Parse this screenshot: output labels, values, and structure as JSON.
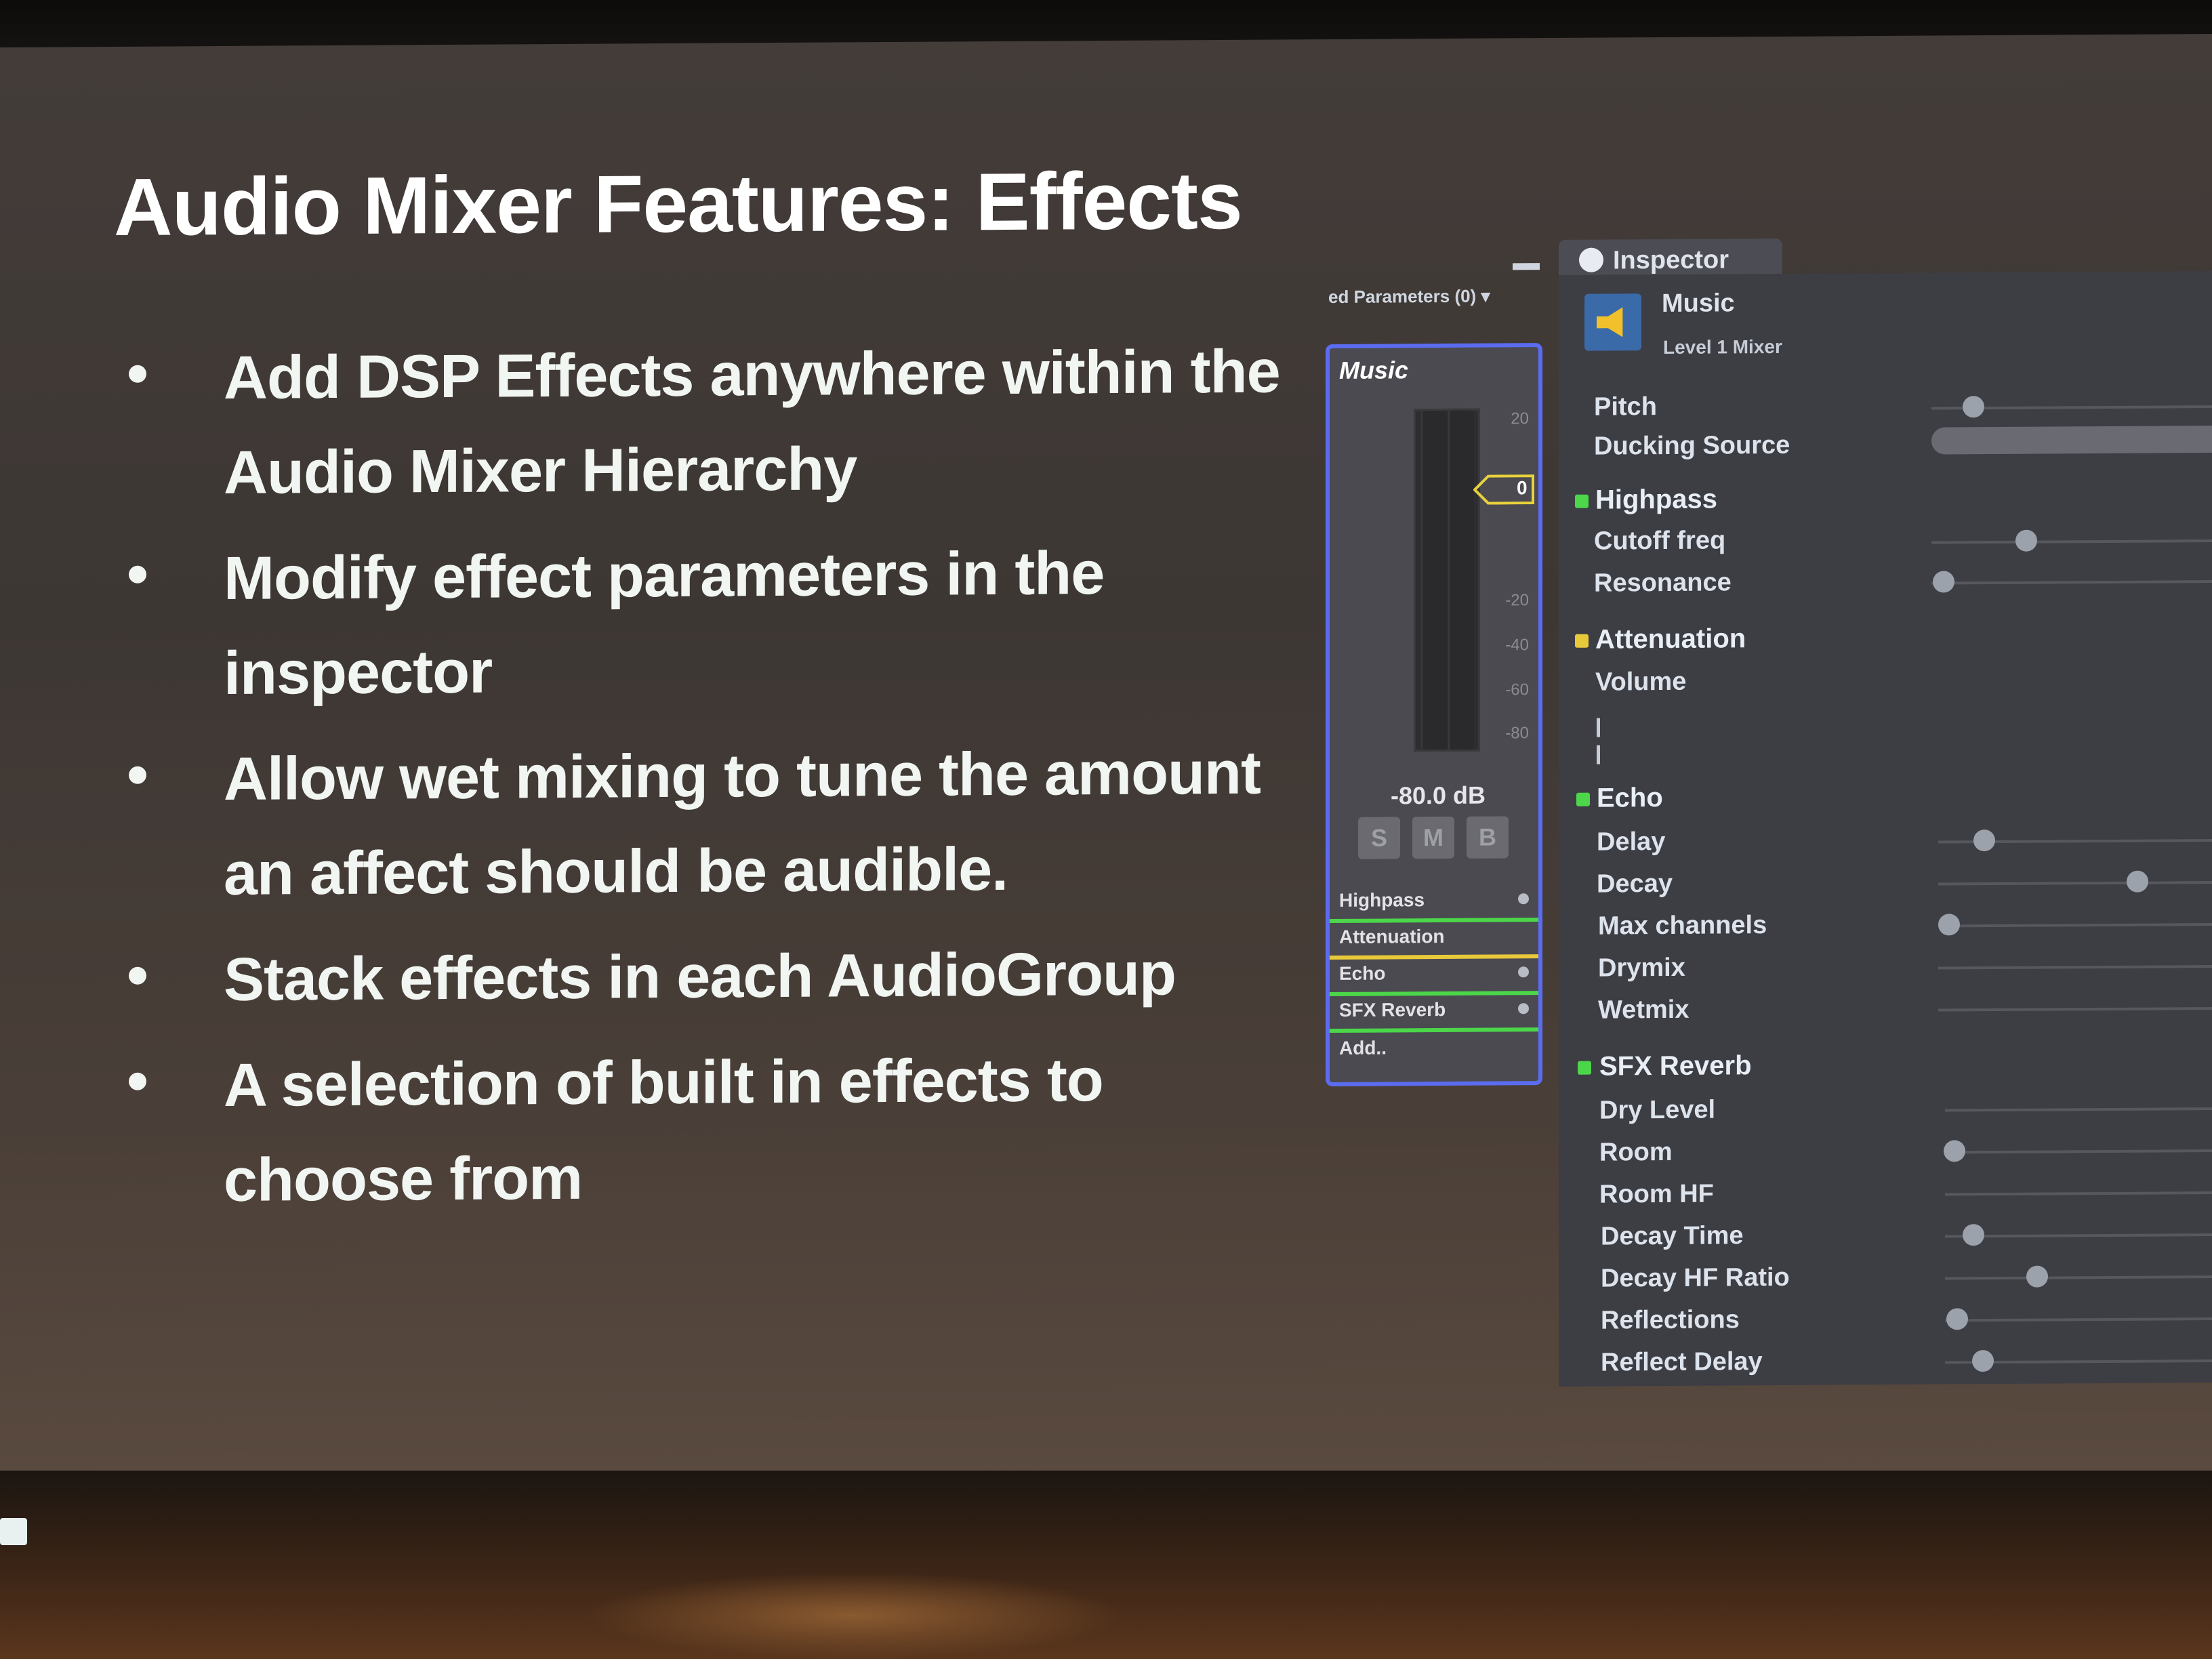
{
  "slide": {
    "title": "Audio Mixer Features: Effects",
    "bullets": [
      "Add DSP Effects anywhere within the Audio Mixer Hierarchy",
      "Modify effect parameters in the inspector",
      "Allow wet mixing to tune the amount an affect should be audible.",
      "Stack effects in each AudioGroup",
      "A selection of built in effects to choose from"
    ]
  },
  "mixer": {
    "header": "ed Parameters (0) ▾",
    "group_name": "Music",
    "db_scale": [
      "20",
      "-20",
      "-40",
      "-60",
      "-80"
    ],
    "fader_value": "0",
    "db_readout": "-80.0 dB",
    "buttons": [
      "S",
      "M",
      "B"
    ],
    "effects": [
      {
        "label": "Highpass",
        "color": "#4cd64a"
      },
      {
        "label": "Attenuation",
        "color": "#e8c93a"
      },
      {
        "label": "Echo",
        "color": "#4cd64a"
      },
      {
        "label": "SFX Reverb",
        "color": "#4cd64a"
      }
    ],
    "add_label": "Add.."
  },
  "inspector": {
    "tab_label": "Inspector",
    "object_name": "Music",
    "object_subtitle": "Level 1 Mixer",
    "params_top": [
      "Pitch",
      "Ducking Source"
    ],
    "sections": [
      {
        "title": "Highpass",
        "color": "#4cd64a",
        "params": [
          "Cutoff freq",
          "Resonance"
        ]
      },
      {
        "title": "Attenuation",
        "color": "#e8c93a",
        "params": [
          "Volume"
        ]
      },
      {
        "title": "Echo",
        "color": "#4cd64a",
        "params": [
          "Delay",
          "Decay",
          "Max channels",
          "Drymix",
          "Wetmix"
        ]
      },
      {
        "title": "SFX Reverb",
        "color": "#4cd64a",
        "params": [
          "Dry Level",
          "Room",
          "Room HF",
          "Decay Time",
          "Decay HF Ratio",
          "Reflections",
          "Reflect Delay"
        ]
      }
    ]
  }
}
